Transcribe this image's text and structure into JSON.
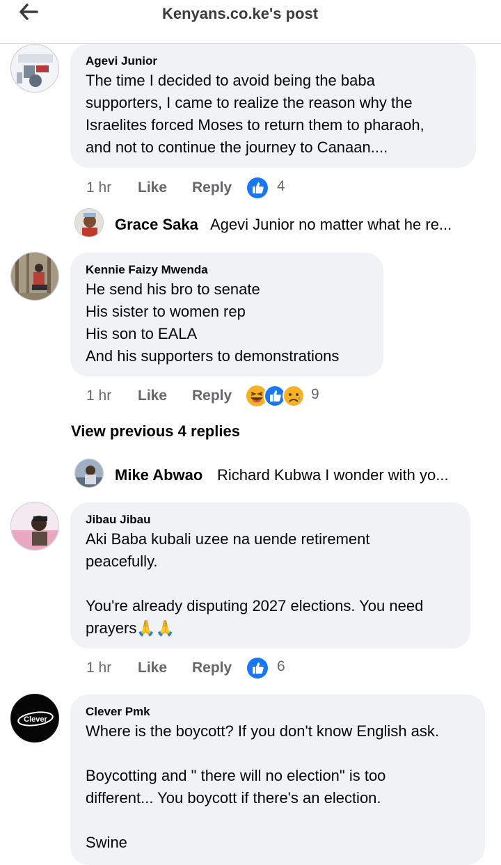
{
  "header": {
    "title": "Kenyans.co.ke's post",
    "back_icon": "back-arrow-icon"
  },
  "colors": {
    "like_blue": "#1877f2",
    "bubble_bg": "#f0f2f5",
    "meta_gray": "#65676b"
  },
  "comments": [
    {
      "author": "Agevi Junior",
      "text": "The time I decided to avoid being the baba\nsupporters, I came to realize the reason why the\nIsraelites forced Moses to return them to pharaoh,\nand not to continue the journey to Canaan....",
      "time": "1 hr",
      "like": "Like",
      "reply": "Reply",
      "reactions": [
        "like"
      ],
      "count": "4"
    },
    {
      "author": "Kennie Faizy Mwenda",
      "text": "He send his bro to senate\nHis sister to women rep\nHis son to EALA\nAnd his supporters to demonstrations",
      "time": "1 hr",
      "like": "Like",
      "reply": "Reply",
      "reactions": [
        "haha",
        "like",
        "sad"
      ],
      "count": "9"
    },
    {
      "author": "Jibau Jibau",
      "text": "Aki Baba kubali uzee na uende retirement\npeacefully.\n\nYou're already disputing 2027 elections. You need\nprayers",
      "emoji": "🙏🙏",
      "time": "1 hr",
      "like": "Like",
      "reply": "Reply",
      "reactions": [
        "like"
      ],
      "count": "6"
    },
    {
      "author": "Clever Pmk",
      "avatar_logo": "Clever",
      "text": "Where is the boycott? If you don't know English ask.\n\nBoycotting and \" there will no election\" is too\ndifferent... You boycott if there's an election.\n\nSwine"
    }
  ],
  "replies": [
    {
      "author": "Grace Saka",
      "text": "Agevi Junior no matter what he re..."
    },
    {
      "author": "Mike Abwao",
      "text": "Richard Kubwa I wonder with yo..."
    }
  ],
  "view_previous": "View previous 4 replies"
}
